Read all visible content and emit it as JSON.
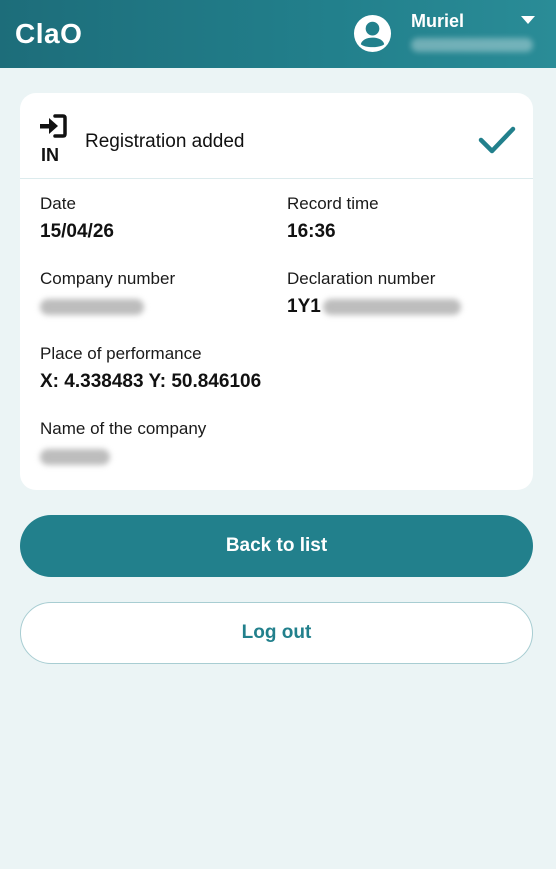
{
  "header": {
    "logo": "ClaO",
    "user_name": "Muriel"
  },
  "registration": {
    "direction": "IN",
    "title": "Registration added",
    "date_label": "Date",
    "date_value": "15/04/26",
    "time_label": "Record time",
    "time_value": "16:36",
    "company_number_label": "Company number",
    "declaration_number_label": "Declaration number",
    "declaration_number_prefix": "1Y1",
    "place_label": "Place of performance",
    "place_value": "X: 4.338483 Y: 50.846106",
    "company_name_label": "Name of the company"
  },
  "actions": {
    "back_label": "Back to list",
    "logout_label": "Log out"
  },
  "colors": {
    "accent": "#22808c",
    "background": "#ebf4f5"
  },
  "icons": {
    "user": "user-circle-icon",
    "dropdown": "chevron-down-icon",
    "direction": "sign-in-icon",
    "status": "check-icon"
  }
}
